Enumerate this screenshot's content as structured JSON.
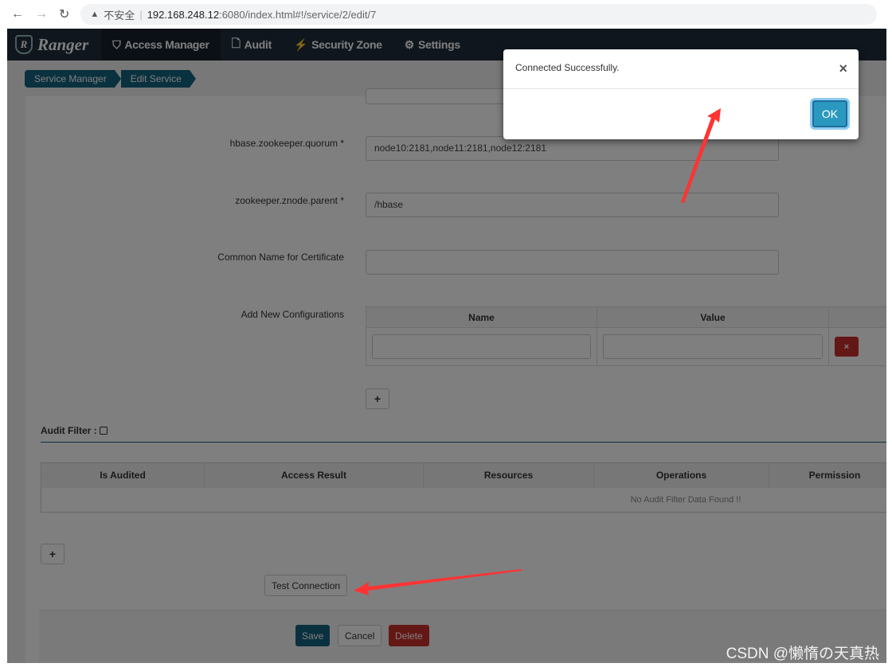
{
  "browser": {
    "security_label": "不安全",
    "url_host": "192.168.248.12",
    "url_path": ":6080/index.html#!/service/2/edit/7"
  },
  "nav": {
    "brand": "Ranger",
    "items": [
      {
        "label": "Access Manager",
        "icon": "shield-icon"
      },
      {
        "label": "Audit",
        "icon": "file-icon"
      },
      {
        "label": "Security Zone",
        "icon": "bolt-icon"
      },
      {
        "label": "Settings",
        "icon": "gear-icon"
      }
    ]
  },
  "breadcrumb": [
    "Service Manager",
    "Edit Service"
  ],
  "form": {
    "quorum": {
      "label": "hbase.zookeeper.quorum *",
      "value": "node10:2181,node11:2181,node12:2181"
    },
    "znode": {
      "label": "zookeeper.znode.parent *",
      "value": "/hbase"
    },
    "cn": {
      "label": "Common Name for Certificate",
      "value": ""
    },
    "configs": {
      "label": "Add New Configurations",
      "headers": [
        "Name",
        "Value"
      ],
      "remove": "×",
      "add": "+"
    }
  },
  "audit_filter": {
    "label": "Audit Filter :",
    "headers": [
      "Is Audited",
      "Access Result",
      "Resources",
      "Operations",
      "Permission"
    ],
    "empty": "No Audit Filter Data Found !!",
    "add": "+"
  },
  "buttons": {
    "test": "Test Connection",
    "save": "Save",
    "cancel": "Cancel",
    "delete": "Delete"
  },
  "modal": {
    "message": "Connected Successfully.",
    "close": "×",
    "ok": "OK"
  },
  "watermark": "CSDN @懒惰の天真热",
  "colors": {
    "nav": "#1f2d3a",
    "primary": "#15627f",
    "danger": "#c9302c",
    "ok": "#2b99bf",
    "annotation": "#ff3333"
  }
}
